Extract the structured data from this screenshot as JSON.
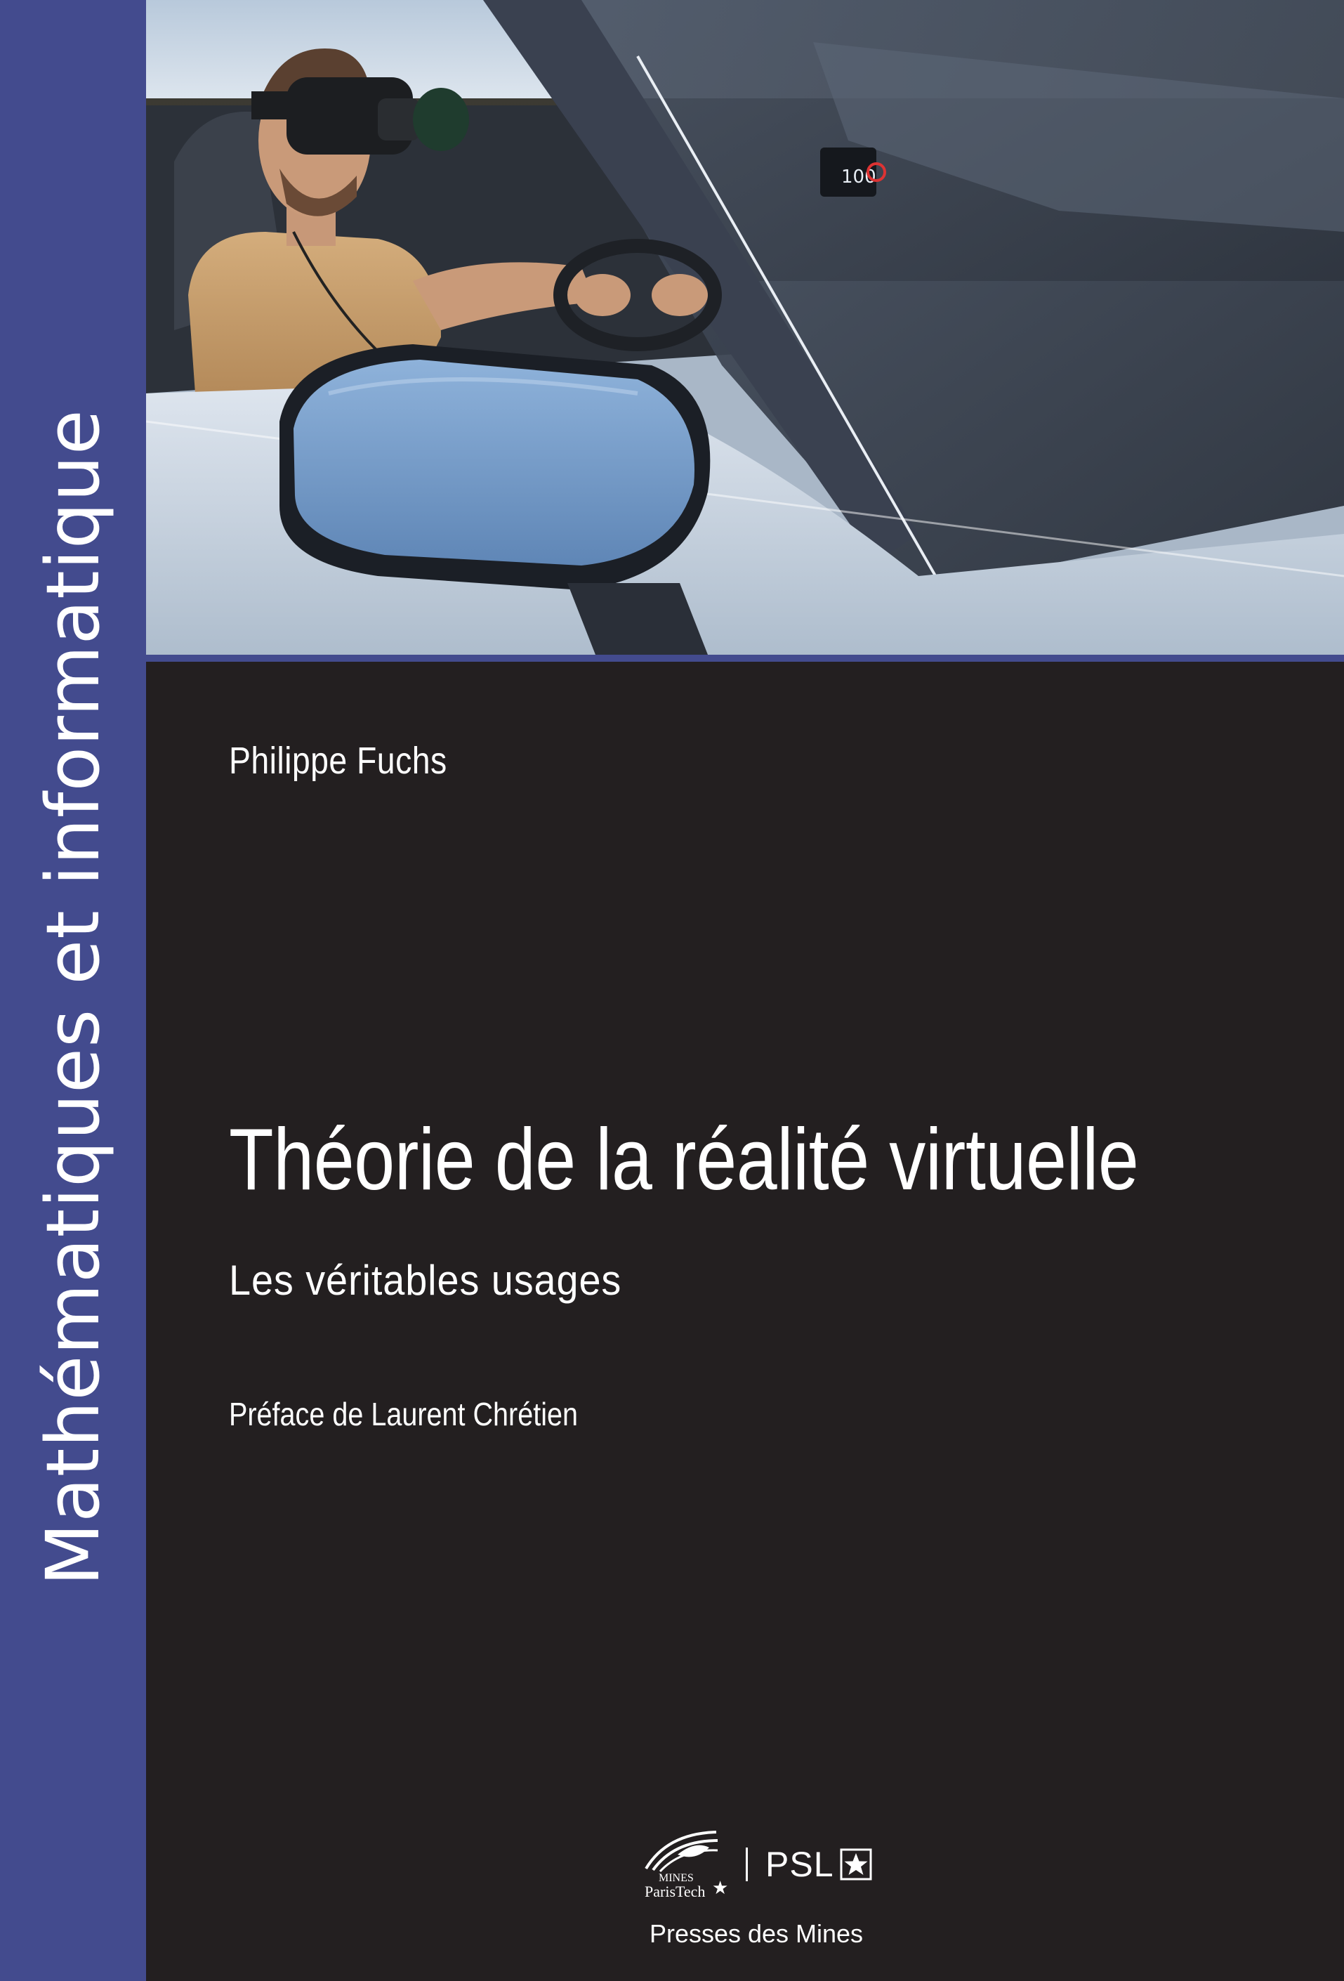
{
  "cover": {
    "series_title": "Mathématiques et informatique",
    "author": "Philippe Fuchs",
    "title": "Théorie de la réalité virtuelle",
    "subtitle": "Les véritables usages",
    "preface": "Préface de Laurent Chrétien",
    "publisher": "Presses des Mines"
  },
  "dashboard_speed": "100",
  "logos": {
    "mines_line1": "MINES",
    "mines_line2": "ParisTech",
    "psl": "PSL",
    "psl_icon": "star-icon",
    "mines_icon": "star-icon"
  },
  "colors": {
    "band": "#434b8e",
    "background": "#231f20",
    "text": "#ffffff",
    "mirror": "#7ea3cf"
  }
}
